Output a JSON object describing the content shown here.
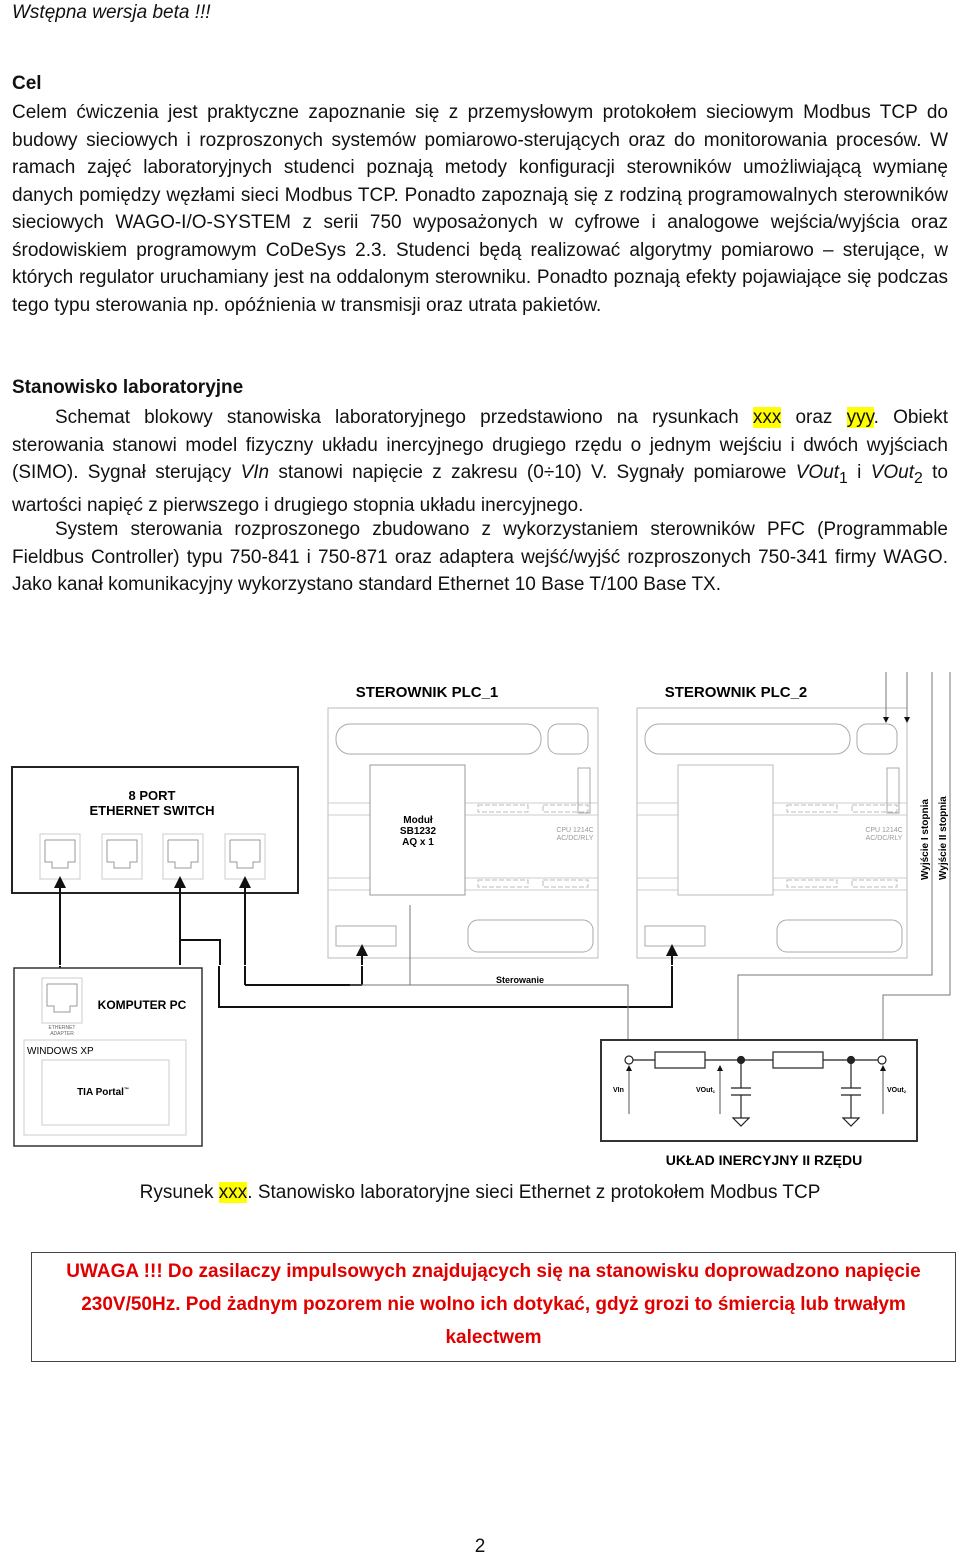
{
  "header": {
    "beta_note": "Wstępna wersja beta !!!"
  },
  "section_goal": {
    "heading": "Cel",
    "paragraph": "Celem ćwiczenia jest praktyczne zapoznanie się z przemysłowym protokołem sieciowym Modbus TCP do budowy sieciowych i rozproszonych systemów pomiarowo-sterujących oraz do monitorowania procesów. W ramach zajęć laboratoryjnych studenci poznają metody konfiguracji sterowników umożliwiającą wymianę danych pomiędzy węzłami sieci Modbus TCP. Ponadto zapoznają się z rodziną programowalnych sterowników sieciowych WAGO-I/O-SYSTEM z serii 750 wyposażonych w cyfrowe i analogowe wejścia/wyjścia oraz środowiskiem programowym CoDeSys 2.3. Studenci będą realizować algorytmy pomiarowo – sterujące, w których regulator uruchamiany jest na oddalonym sterowniku. Ponadto poznają efekty pojawiające się podczas tego typu sterowania np. opóźnienia w transmisji oraz utrata pakietów."
  },
  "section_lab": {
    "heading": "Stanowisko laboratoryjne",
    "p1": {
      "before_xxx": "Schemat blokowy stanowiska laboratoryjnego przedstawiono na rysunkach ",
      "xxx": "xxx",
      "between": " oraz ",
      "yyy": "yyy",
      "after_yyy": ". Obiekt sterowania stanowi model fizyczny układu inercyjnego drugiego rzędu o jednym wejściu i dwóch wyjściach (SIMO). Sygnał sterujący ",
      "vin": "VIn",
      "after_vin": " stanowi napięcie z zakresu (0÷10) V. Sygnały pomiarowe ",
      "vout": "VOut",
      "sub1": "1",
      "and": " i ",
      "sub2": "2",
      "end": " to wartości napięć z pierwszego i drugiego stopnia układu inercyjnego."
    },
    "p2": "System sterowania rozproszonego zbudowano z wykorzystaniem sterowników PFC (Programmable Fieldbus Controller) typu 750-841 i 750-871 oraz adaptera wejść/wyjść rozproszonych 750-341 firmy WAGO. Jako kanał komunikacyjny wykorzystano standard Ethernet 10 Base T/100 Base TX."
  },
  "figure": {
    "plc1_title": "STEROWNIK PLC_1",
    "plc2_title": "STEROWNIK PLC_2",
    "switch_line1": "8 PORT",
    "switch_line2": "ETHERNET SWITCH",
    "module_line1": "Moduł",
    "module_line2": "SB1232",
    "module_line3": "AQ x 1",
    "cpu_label": "CPU 1214C",
    "cpu_sub": "AC/DC/RLY",
    "out1_label": "Wyjście I stopnia",
    "out2_label": "Wyjście II stopnia",
    "pc_title": "KOMPUTER PC",
    "eth_adapter_1": "ETHERNET",
    "eth_adapter_2": "ADAPTER",
    "os_label": "WINDOWS XP",
    "software_label": "TIA Portal",
    "tm": "™",
    "control_label": "Sterowanie",
    "vin_label": "VIn",
    "vout1_label": "VOut",
    "vout1_sub": "1",
    "vout2_label": "VOut",
    "vout2_sub": "2",
    "plant_title": "UKŁAD INERCYJNY II RZĘDU"
  },
  "caption": {
    "prefix": "Rysunek ",
    "ref": "xxx",
    "text": ". Stanowisko laboratoryjne sieci Ethernet z protokołem Modbus TCP"
  },
  "warning": {
    "text": "UWAGA !!! Do zasilaczy impulsowych znajdujących się na stanowisku doprowadzono napięcie 230V/50Hz. Pod żadnym pozorem nie wolno ich dotykać, gdyż grozi to śmiercią lub trwałym kalectwem",
    "color": "#e00000"
  },
  "page_number": "2"
}
